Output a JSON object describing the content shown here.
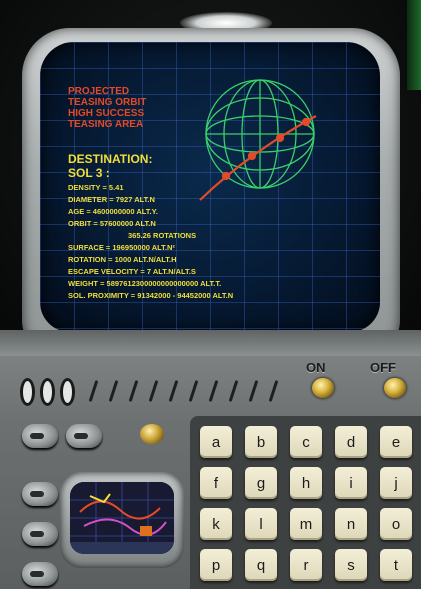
{
  "screen": {
    "header": "",
    "mission": [
      "PROJECTED",
      "TEASING ORBIT",
      "HIGH SUCCESS",
      "TEASING AREA"
    ],
    "destination_title": "DESTINATION:",
    "destination_name": "SOL 3 :",
    "stats": [
      "DENSITY = 5.41",
      "DIAMETER = 7927 ALT.N",
      "AGE = 4600000000 ALT.Y.",
      "ORBIT = 57600000 ALT.N",
      "365.26 ROTATIONS",
      "SURFACE = 196950000 ALT.N²",
      "ROTATION = 1000 ALT.N/ALT.H",
      "ESCAPE VELOCITY = 7 ALT.N/ALT.S",
      "WEIGHT = 5897612300000000000000 ALT.T.",
      "SOL. PROXIMITY = 91342000 - 94452000 ALT.N"
    ]
  },
  "controls": {
    "on_label": "ON",
    "off_label": "OFF"
  },
  "keypad": {
    "keys": [
      "a",
      "b",
      "c",
      "d",
      "e",
      "f",
      "g",
      "h",
      "i",
      "j",
      "k",
      "l",
      "m",
      "n",
      "o",
      "p",
      "q",
      "r",
      "s",
      "t"
    ]
  },
  "colors": {
    "screen_red": "#e24a2a",
    "screen_yellow": "#f2df3a",
    "globe_green": "#39d06a",
    "grid_blue": "#3c6edc"
  },
  "icons": [
    "globe-icon",
    "trajectory-icon"
  ]
}
